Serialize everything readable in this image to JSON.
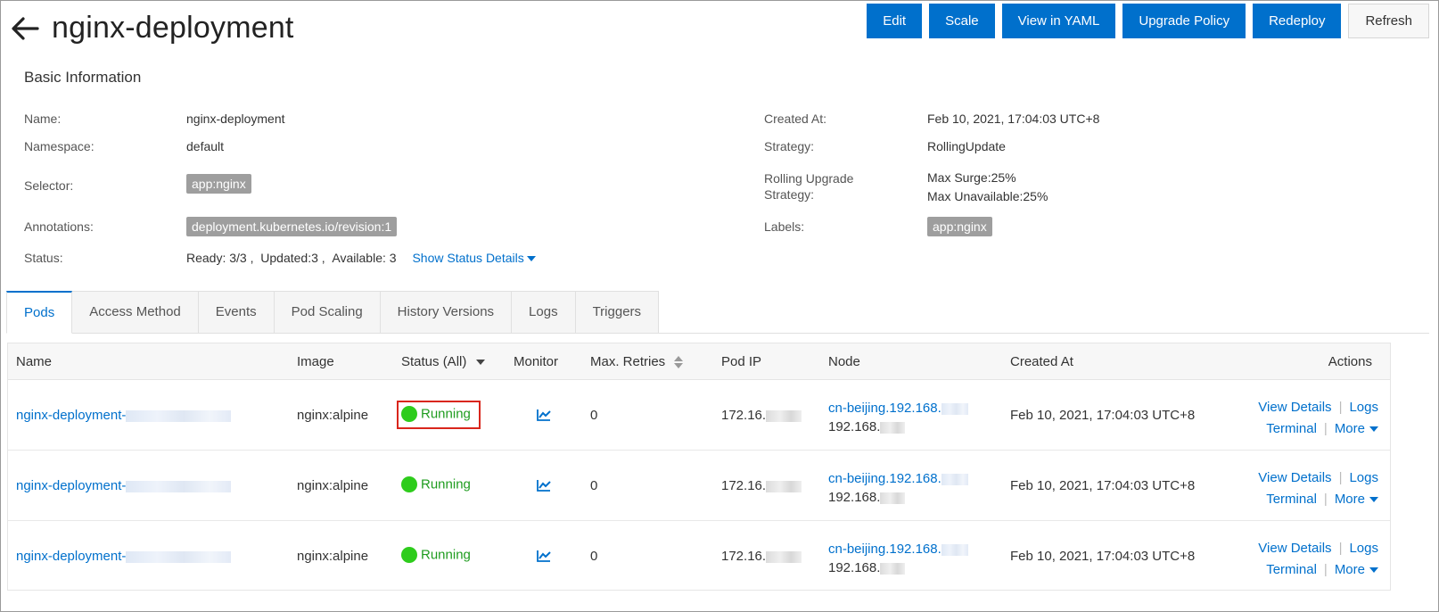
{
  "header": {
    "title": "nginx-deployment",
    "actions": [
      "Edit",
      "Scale",
      "View in YAML",
      "Upgrade Policy",
      "Redeploy",
      "Refresh"
    ]
  },
  "basic_info": {
    "title": "Basic Information",
    "name_label": "Name:",
    "name_value": "nginx-deployment",
    "namespace_label": "Namespace:",
    "namespace_value": "default",
    "selector_label": "Selector:",
    "selector_tag": "app:nginx",
    "annotations_label": "Annotations:",
    "annotations_tag": "deployment.kubernetes.io/revision:1",
    "status_label": "Status:",
    "status_value": "Ready: 3/3 ,  Updated:3 ,  Available: 3",
    "show_status_details": "Show Status Details",
    "created_label": "Created At:",
    "created_value": "Feb 10, 2021, 17:04:03 UTC+8",
    "strategy_label": "Strategy:",
    "strategy_value": "RollingUpdate",
    "rolling_label_line1": "Rolling Upgrade",
    "rolling_label_line2": "Strategy:",
    "max_surge": "Max Surge:25%",
    "max_unavailable": "Max Unavailable:25%",
    "labels_label": "Labels:",
    "labels_tag": "app:nginx"
  },
  "tabs": [
    "Pods",
    "Access Method",
    "Events",
    "Pod Scaling",
    "History Versions",
    "Logs",
    "Triggers"
  ],
  "table": {
    "columns": {
      "name": "Name",
      "image": "Image",
      "status": "Status (All)",
      "monitor": "Monitor",
      "max_retries": "Max. Retries",
      "pod_ip": "Pod IP",
      "node": "Node",
      "created_at": "Created At",
      "actions": "Actions"
    },
    "rows": [
      {
        "name": "nginx-deployment-",
        "image": "nginx:alpine",
        "status": "Running",
        "retries": "0",
        "pod_ip": "172.16.",
        "node_name": "cn-beijing.192.168.",
        "node_ip": "192.168.",
        "created": "Feb 10, 2021, 17:04:03 UTC+8"
      },
      {
        "name": "nginx-deployment-",
        "image": "nginx:alpine",
        "status": "Running",
        "retries": "0",
        "pod_ip": "172.16.",
        "node_name": "cn-beijing.192.168.",
        "node_ip": "192.168.",
        "created": "Feb 10, 2021, 17:04:03 UTC+8"
      },
      {
        "name": "nginx-deployment-",
        "image": "nginx:alpine",
        "status": "Running",
        "retries": "0",
        "pod_ip": "172.16.",
        "node_name": "cn-beijing.192.168.",
        "node_ip": "192.168.",
        "created": "Feb 10, 2021, 17:04:03 UTC+8"
      }
    ],
    "row_actions": {
      "view_details": "View Details",
      "logs": "Logs",
      "terminal": "Terminal",
      "more": "More",
      "separator": "|"
    }
  },
  "colors": {
    "primary": "#0070cc",
    "running": "#2ecc1c",
    "highlight": "#d9261c"
  }
}
